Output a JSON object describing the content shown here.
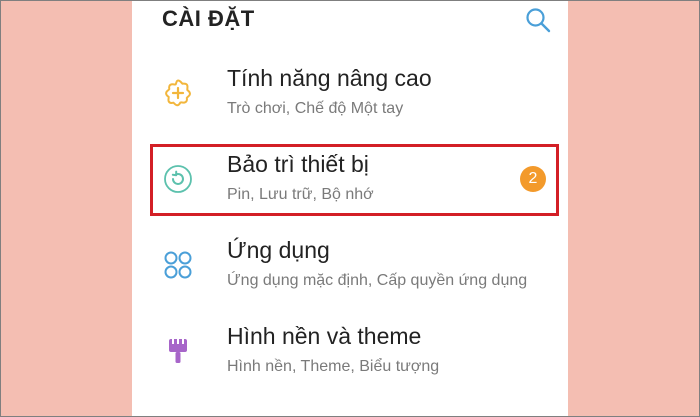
{
  "header": {
    "title": "CÀI ĐẶT",
    "search_icon": "search-icon"
  },
  "items": [
    {
      "title": "Tính năng nâng cao",
      "subtitle": "Trò chơi, Chế độ Một tay",
      "icon": "advanced-features-icon",
      "icon_color": "#f2b63c"
    },
    {
      "title": "Bảo trì thiết bị",
      "subtitle": "Pin, Lưu trữ, Bộ nhớ",
      "icon": "device-maintenance-icon",
      "icon_color": "#5cc1ad",
      "badge": "2",
      "highlighted": true
    },
    {
      "title": "Ứng dụng",
      "subtitle": "Ứng dụng mặc định, Cấp quyền ứng dụng",
      "icon": "apps-icon",
      "icon_color": "#4a9fd8"
    },
    {
      "title": "Hình nền và theme",
      "subtitle": "Hình nền, Theme, Biểu tượng",
      "icon": "wallpaper-theme-icon",
      "icon_color": "#a765c9"
    }
  ],
  "colors": {
    "background": "#f4beb2",
    "highlight_border": "#d31f26",
    "badge": "#f39a2b",
    "search": "#4a9fd8"
  }
}
